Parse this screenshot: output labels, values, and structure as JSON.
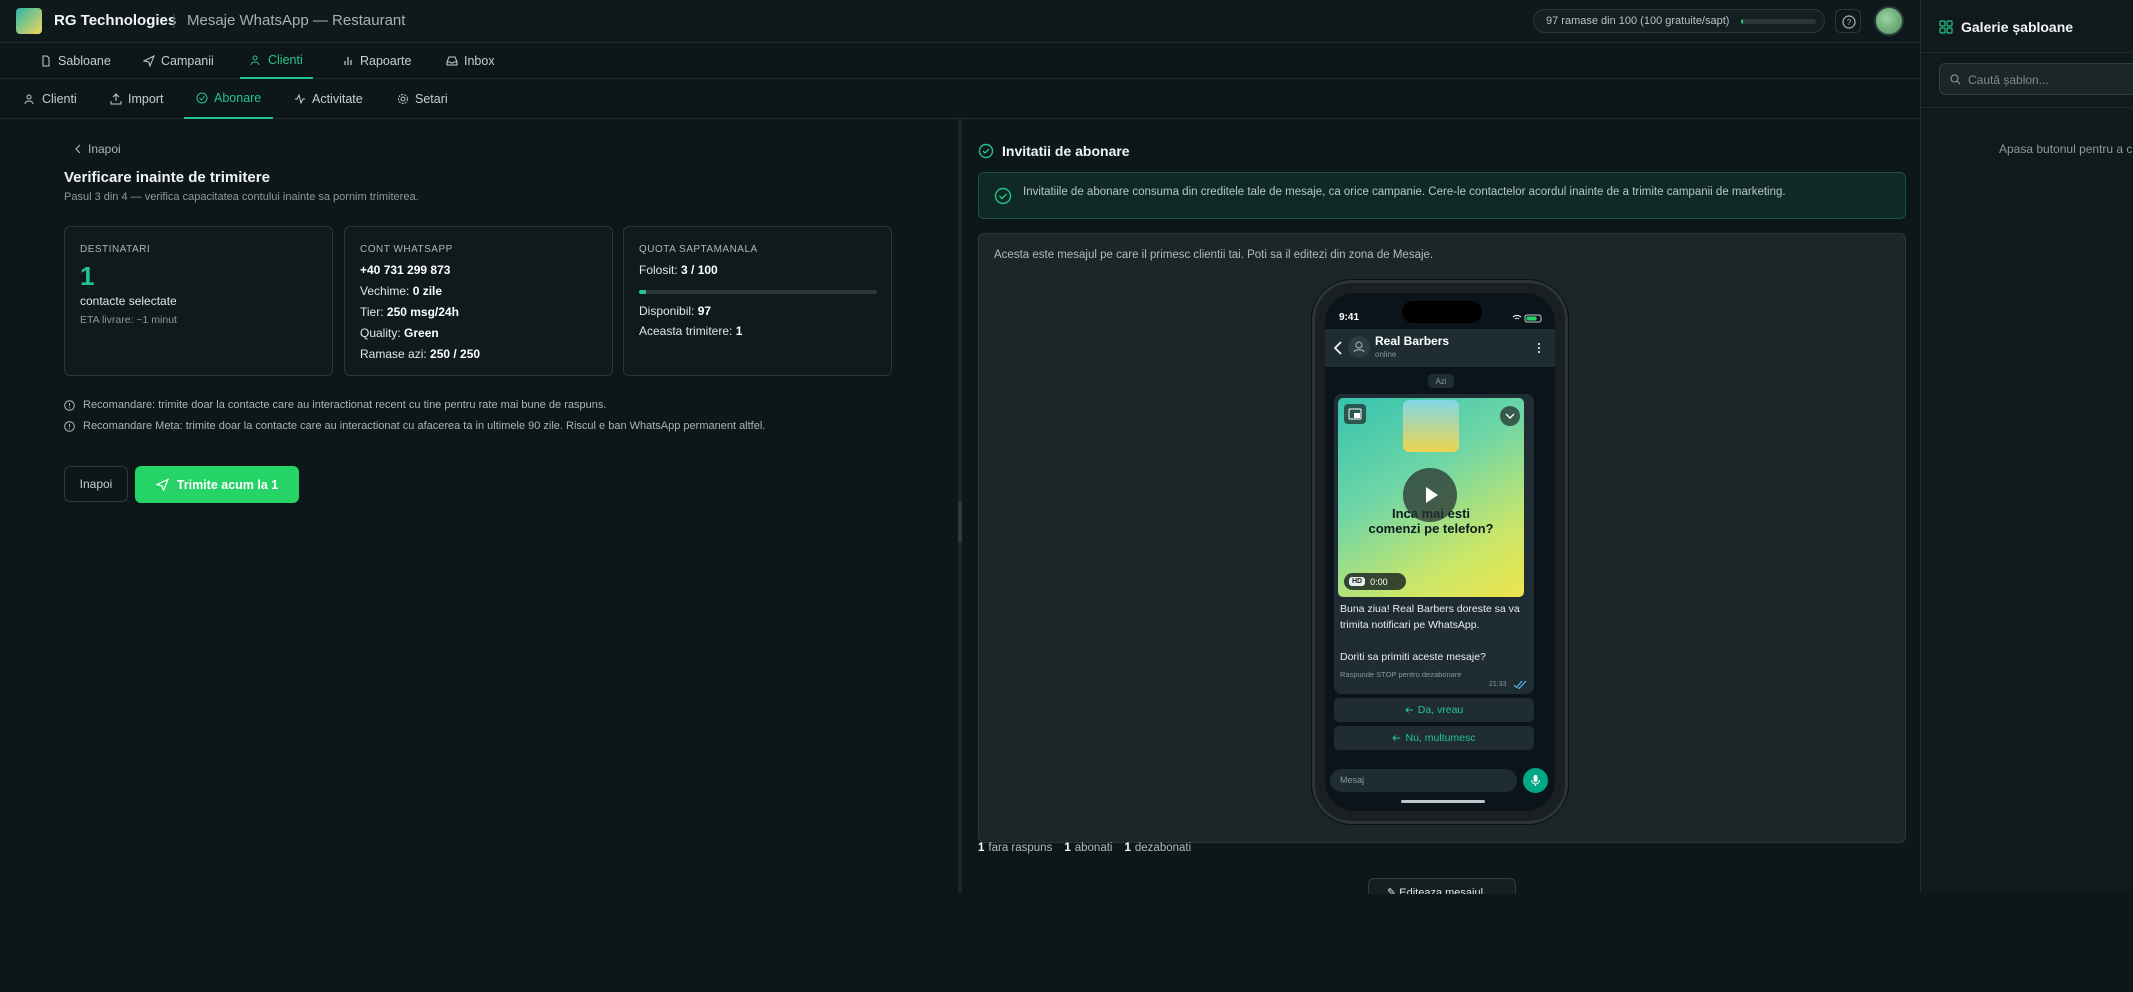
{
  "header": {
    "brand": "RG Technologies",
    "separator": "|",
    "subtitle": "Mesaje WhatsApp — Restaurant",
    "quota_text": "97 ramase din 100 (100 gratuite/sapt)",
    "quota_used_fraction": 0.03
  },
  "nav": {
    "primary": [
      {
        "label": "Sabloane",
        "icon": "document-icon"
      },
      {
        "label": "Campanii",
        "icon": "send-icon"
      },
      {
        "label": "Clienti",
        "icon": "users-icon",
        "active": true
      },
      {
        "label": "Rapoarte",
        "icon": "bar-chart-icon"
      },
      {
        "label": "Inbox",
        "icon": "inbox-icon"
      }
    ],
    "secondary": [
      {
        "label": "Clienti",
        "icon": "users-icon"
      },
      {
        "label": "Import",
        "icon": "upload-icon"
      },
      {
        "label": "Abonare",
        "icon": "check-circle-icon",
        "active": true
      },
      {
        "label": "Activitate",
        "icon": "activity-icon"
      },
      {
        "label": "Setari",
        "icon": "gear-icon"
      }
    ]
  },
  "verify": {
    "back_label": "Inapoi",
    "title": "Verificare inainte de trimitere",
    "subtitle": "Pasul 3 din 4 — verifica capacitatea contului inainte sa pornim trimiterea.",
    "recipients": {
      "heading": "DESTINATARI",
      "count": "1",
      "count_label": "contacte selectate",
      "eta": "ETA livrare: ~1 minut"
    },
    "account": {
      "heading": "CONT WHATSAPP",
      "phone": "+40 731 299 873",
      "age_label": "Vechime: ",
      "age_value": "0 zile",
      "tier_label": "Tier: ",
      "tier_value": "250 msg/24h",
      "quality_label": "Quality: ",
      "quality_value": "Green",
      "remaining_label": "Ramase azi: ",
      "remaining_value": "250 / 250"
    },
    "quota": {
      "heading": "QUOTA SAPTAMANALA",
      "used_label": "Folosit: ",
      "used_value": "3 / 100",
      "used_fraction": 0.03,
      "available_label": "Disponibil: ",
      "available_value": "97",
      "this_send_label": "Aceasta trimitere: ",
      "this_send_value": "1"
    },
    "recommendations": [
      "Recomandare: trimite doar la contacte care au interactionat recent cu tine pentru rate mai bune de raspuns.",
      "Recomandare Meta: trimite doar la contacte care au interactionat cu afacerea ta in ultimele 90 zile. Riscul e ban WhatsApp permanent altfel."
    ],
    "back_button": "Inapoi",
    "send_button": "Trimite acum la 1"
  },
  "invitations": {
    "title": "Invitatii de abonare",
    "alert": "Invitatiile de abonare consuma din creditele tale de mesaje, ca orice campanie. Cere-le contactelor acordul inainte de a trimite campanii de marketing.",
    "preview_note": "Acesta este mesajul pe care il primesc clientii tai. Poti sa il editezi din zona de Mesaje.",
    "stats": [
      {
        "value": "1",
        "label": "fara raspuns"
      },
      {
        "value": "1",
        "label": "abonati"
      },
      {
        "value": "1",
        "label": "dezabonati"
      }
    ],
    "edit_button": "✎ Editeaza mesajul"
  },
  "phone": {
    "time": "9:41",
    "contact_name": "Real Barbers",
    "contact_status": "online",
    "day_chip": "Azi",
    "media_headline": "Inca mai esti\ncomenzi pe telefon?",
    "video_quality": "HD",
    "video_duration": "0:00",
    "message_body": "Buna ziua! Real Barbers doreste sa va trimita notificari pe WhatsApp.\n\nDoriti sa primiti aceste mesaje?",
    "message_footer": "Raspunde STOP pentru dezabonare",
    "message_time": "21:33",
    "quick_replies": [
      "Da, vreau",
      "Nu, multumesc"
    ],
    "input_placeholder": "Mesaj"
  },
  "drawer": {
    "title": "Galerie șabloane",
    "search_placeholder": "Caută șablon...",
    "empty_text": "Apasa butonul pentru a c"
  },
  "colors": {
    "accent": "#25c48a",
    "whatsapp_green": "#25d366",
    "background": "#0d1619"
  }
}
